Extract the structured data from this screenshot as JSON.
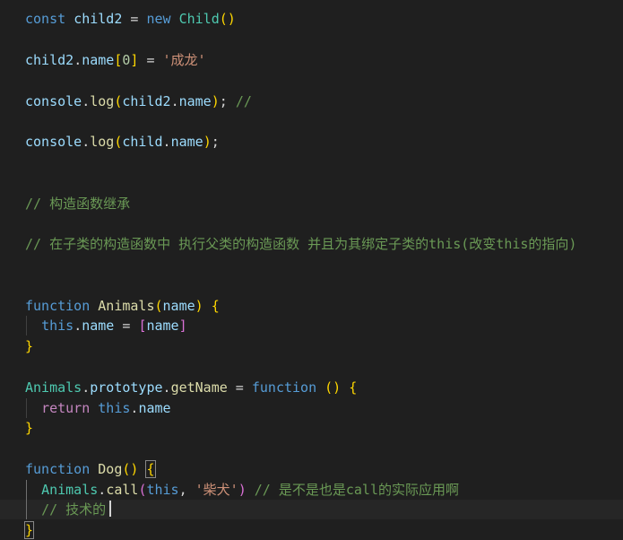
{
  "editor": {
    "lines": [
      {
        "id": "l1",
        "tokens": [
          {
            "t": "const",
            "c": "k-kw"
          },
          {
            "t": " ",
            "c": "k-p"
          },
          {
            "t": "child2",
            "c": "k-var"
          },
          {
            "t": " = ",
            "c": "k-p"
          },
          {
            "t": "new",
            "c": "k-kw"
          },
          {
            "t": " ",
            "c": "k-p"
          },
          {
            "t": "Child",
            "c": "k-cls"
          },
          {
            "t": "()",
            "c": "b1"
          }
        ]
      },
      {
        "id": "l2",
        "tokens": [
          {
            "t": "child2",
            "c": "k-var"
          },
          {
            "t": ".",
            "c": "k-p"
          },
          {
            "t": "name",
            "c": "k-var"
          },
          {
            "t": "[",
            "c": "b1"
          },
          {
            "t": "0",
            "c": "k-num"
          },
          {
            "t": "]",
            "c": "b1"
          },
          {
            "t": " = ",
            "c": "k-p"
          },
          {
            "t": "'成龙'",
            "c": "k-str"
          }
        ]
      },
      {
        "id": "l3",
        "tokens": [
          {
            "t": "console",
            "c": "k-var"
          },
          {
            "t": ".",
            "c": "k-p"
          },
          {
            "t": "log",
            "c": "k-fn"
          },
          {
            "t": "(",
            "c": "b1"
          },
          {
            "t": "child2",
            "c": "k-var"
          },
          {
            "t": ".",
            "c": "k-p"
          },
          {
            "t": "name",
            "c": "k-var"
          },
          {
            "t": ")",
            "c": "b1"
          },
          {
            "t": "; ",
            "c": "k-p"
          },
          {
            "t": "//",
            "c": "k-cmt"
          }
        ]
      },
      {
        "id": "l4",
        "tokens": [
          {
            "t": "console",
            "c": "k-var"
          },
          {
            "t": ".",
            "c": "k-p"
          },
          {
            "t": "log",
            "c": "k-fn"
          },
          {
            "t": "(",
            "c": "b1"
          },
          {
            "t": "child",
            "c": "k-var"
          },
          {
            "t": ".",
            "c": "k-p"
          },
          {
            "t": "name",
            "c": "k-var"
          },
          {
            "t": ")",
            "c": "b1"
          },
          {
            "t": ";",
            "c": "k-p"
          }
        ]
      },
      {
        "id": "l5",
        "tokens": [
          {
            "t": "// 构造函数继承",
            "c": "k-cmt"
          }
        ]
      },
      {
        "id": "l6",
        "tokens": [
          {
            "t": "// 在子类的构造函数中 执行父类的构造函数 并且为其绑定子类的this(改变this的指向)",
            "c": "k-cmt"
          }
        ]
      },
      {
        "id": "l7",
        "tokens": [
          {
            "t": "function",
            "c": "k-kw"
          },
          {
            "t": " ",
            "c": "k-p"
          },
          {
            "t": "Animals",
            "c": "k-fn"
          },
          {
            "t": "(",
            "c": "b1"
          },
          {
            "t": "name",
            "c": "k-var"
          },
          {
            "t": ")",
            "c": "b1"
          },
          {
            "t": " ",
            "c": "k-p"
          },
          {
            "t": "{",
            "c": "b1"
          }
        ]
      },
      {
        "id": "l8",
        "indent": true,
        "tokens": [
          {
            "t": "this",
            "c": "k-kw"
          },
          {
            "t": ".",
            "c": "k-p"
          },
          {
            "t": "name",
            "c": "k-var"
          },
          {
            "t": " = ",
            "c": "k-p"
          },
          {
            "t": "[",
            "c": "b2"
          },
          {
            "t": "name",
            "c": "k-var"
          },
          {
            "t": "]",
            "c": "b2"
          }
        ]
      },
      {
        "id": "l9",
        "tokens": [
          {
            "t": "}",
            "c": "b1"
          }
        ]
      },
      {
        "id": "l10",
        "tokens": [
          {
            "t": "Animals",
            "c": "k-cls"
          },
          {
            "t": ".",
            "c": "k-p"
          },
          {
            "t": "prototype",
            "c": "k-var"
          },
          {
            "t": ".",
            "c": "k-p"
          },
          {
            "t": "getName",
            "c": "k-fn"
          },
          {
            "t": " = ",
            "c": "k-p"
          },
          {
            "t": "function",
            "c": "k-kw"
          },
          {
            "t": " ",
            "c": "k-p"
          },
          {
            "t": "()",
            "c": "b1"
          },
          {
            "t": " ",
            "c": "k-p"
          },
          {
            "t": "{",
            "c": "b1"
          }
        ]
      },
      {
        "id": "l11",
        "indent": true,
        "tokens": [
          {
            "t": "return",
            "c": "k-ctl"
          },
          {
            "t": " ",
            "c": "k-p"
          },
          {
            "t": "this",
            "c": "k-kw"
          },
          {
            "t": ".",
            "c": "k-p"
          },
          {
            "t": "name",
            "c": "k-var"
          }
        ]
      },
      {
        "id": "l12",
        "tokens": [
          {
            "t": "}",
            "c": "b1"
          }
        ]
      },
      {
        "id": "l13",
        "tokens": [
          {
            "t": "function",
            "c": "k-kw"
          },
          {
            "t": " ",
            "c": "k-p"
          },
          {
            "t": "Dog",
            "c": "k-fn"
          },
          {
            "t": "()",
            "c": "b1"
          },
          {
            "t": " ",
            "c": "k-p"
          },
          {
            "t": "{",
            "c": "b1 bmatch"
          }
        ]
      },
      {
        "id": "l14",
        "indent": true,
        "tokens": [
          {
            "t": "Animals",
            "c": "k-cls"
          },
          {
            "t": ".",
            "c": "k-p"
          },
          {
            "t": "call",
            "c": "k-fn"
          },
          {
            "t": "(",
            "c": "b2"
          },
          {
            "t": "this",
            "c": "k-kw"
          },
          {
            "t": ", ",
            "c": "k-p"
          },
          {
            "t": "'柴犬'",
            "c": "k-str"
          },
          {
            "t": ")",
            "c": "b2"
          },
          {
            "t": " ",
            "c": "k-p"
          },
          {
            "t": "// 是不是也是call的实际应用啊",
            "c": "k-cmt"
          }
        ]
      },
      {
        "id": "l15",
        "indent": true,
        "cursor": true,
        "tokens": [
          {
            "t": "// 技术的",
            "c": "k-cmt"
          }
        ]
      },
      {
        "id": "l16",
        "tokens": [
          {
            "t": "}",
            "c": "b1 bmatch"
          }
        ]
      }
    ]
  }
}
